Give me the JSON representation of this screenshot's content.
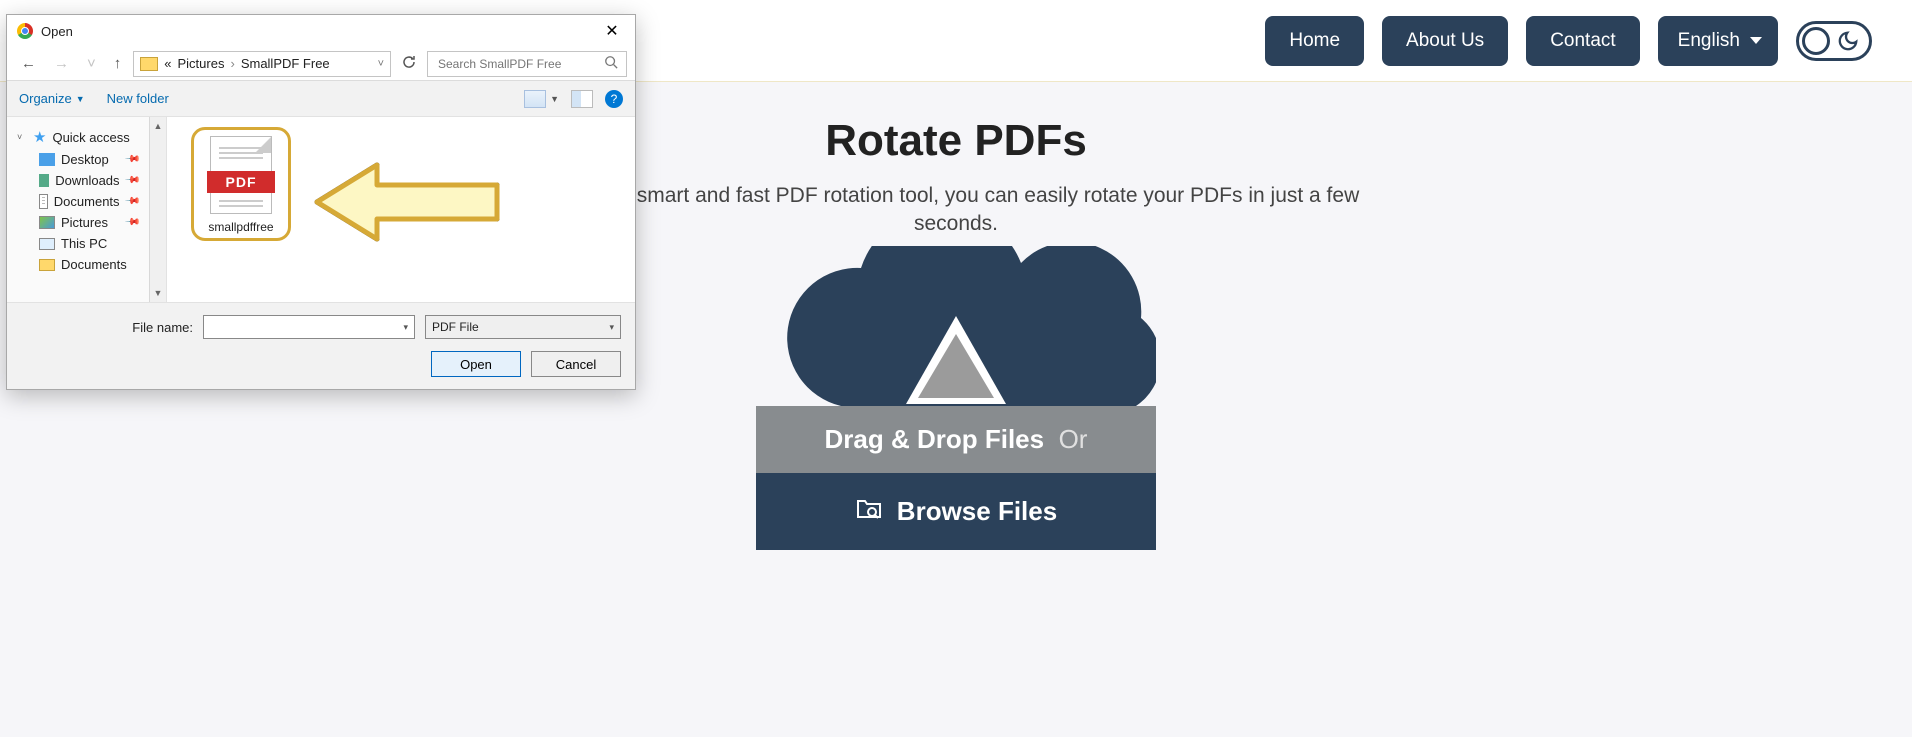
{
  "nav": {
    "home": "Home",
    "about": "About Us",
    "contact": "Contact",
    "language": "English"
  },
  "page": {
    "title": "Rotate PDFs",
    "subtitle_1": "With our smart and fast PDF rotation tool, you can easily rotate your PDFs in just a few",
    "subtitle_2": "seconds.",
    "drag_label": "Drag & Drop Files",
    "drag_or": "Or",
    "browse_label": "Browse Files"
  },
  "dialog": {
    "title": "Open",
    "breadcrumb_root": "«",
    "breadcrumb_1": "Pictures",
    "breadcrumb_2": "SmallPDF Free",
    "search_placeholder": "Search SmallPDF Free",
    "organize": "Organize",
    "new_folder": "New folder",
    "help": "?",
    "sidebar": {
      "quick_access": "Quick access",
      "desktop": "Desktop",
      "downloads": "Downloads",
      "documents": "Documents",
      "pictures": "Pictures",
      "this_pc": "This PC",
      "documents2": "Documents"
    },
    "file": {
      "badge": "PDF",
      "name": "smallpdffree"
    },
    "footer": {
      "file_name_label": "File name:",
      "file_type": "PDF File",
      "open": "Open",
      "cancel": "Cancel"
    }
  }
}
